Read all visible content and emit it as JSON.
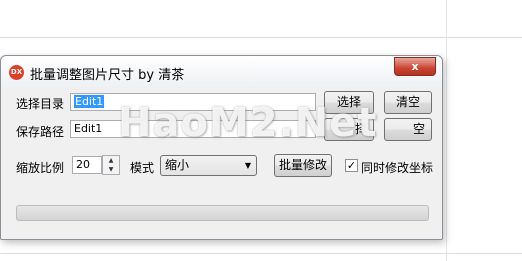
{
  "window": {
    "title": "批量调整图片尺寸 by 清茶",
    "close_label": "x",
    "app_icon_text": "DX"
  },
  "row1": {
    "label": "选择目录",
    "value": "Edit1",
    "select_button": "选择",
    "clear_button": "清空"
  },
  "row2": {
    "label": "保存路径",
    "value": "Edit1",
    "button_a_partial": "择",
    "button_b_partial": "空"
  },
  "row3": {
    "scale_label": "缩放比例",
    "scale_value": "20",
    "mode_label": "模式",
    "mode_selected": "缩小",
    "batch_button": "批量修改",
    "checkbox_label": "同时修改坐标",
    "checkbox_checked": true
  },
  "progress": {
    "value": 0
  },
  "watermark": "HaoM2.Net"
}
